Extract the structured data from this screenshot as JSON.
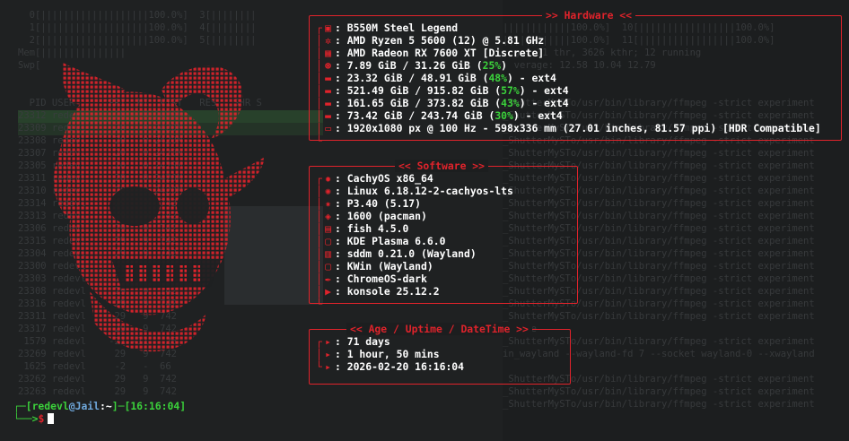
{
  "hardware": {
    "title": ">> Hardware <<",
    "items": [
      {
        "icon": "motherboard-icon",
        "text": "B550M Steel Legend"
      },
      {
        "icon": "cpu-icon",
        "text": "AMD Ryzen 5 5600 (12) @ 5.81 GHz"
      },
      {
        "icon": "gpu-icon",
        "text": "AMD Radeon RX 7600 XT [Discrete]"
      },
      {
        "icon": "memory-icon",
        "pre": "7.89 GiB / 31.26 GiB (",
        "pct": "25%",
        "post": ")"
      },
      {
        "icon": "disk-icon",
        "pre": "23.32 GiB / 48.91 GiB (",
        "pct": "48%",
        "post": ") - ext4"
      },
      {
        "icon": "disk-icon",
        "pre": "521.49 GiB / 915.82 GiB (",
        "pct": "57%",
        "post": ") - ext4"
      },
      {
        "icon": "disk-icon",
        "pre": "161.65 GiB / 373.82 GiB (",
        "pct": "43%",
        "post": ") - ext4"
      },
      {
        "icon": "disk-icon",
        "pre": "73.42 GiB / 243.74 GiB (",
        "pct": "30%",
        "post": ") - ext4"
      },
      {
        "icon": "display-icon",
        "text": "1920x1080 px @ 100 Hz - 598x336 mm (27.01 inches, 81.57 ppi) [HDR Compatible]"
      }
    ]
  },
  "software": {
    "title": "<< Software >>",
    "items": [
      {
        "icon": "os-icon",
        "text": "CachyOS x86_64"
      },
      {
        "icon": "kernel-icon",
        "text": "Linux 6.18.12-2-cachyos-lts"
      },
      {
        "icon": "init-icon",
        "text": "P3.40 (5.17)"
      },
      {
        "icon": "package-icon",
        "text": "1600 (pacman)"
      },
      {
        "icon": "shell-icon",
        "text": "fish 4.5.0"
      },
      {
        "icon": "desktop-icon",
        "text": "KDE Plasma 6.6.0"
      },
      {
        "icon": "login-manager-icon",
        "text": "sddm 0.21.0 (Wayland)"
      },
      {
        "icon": "window-manager-icon",
        "text": "KWin (Wayland)"
      },
      {
        "icon": "theme-icon",
        "text": "ChromeOS-dark"
      },
      {
        "icon": "terminal-icon",
        "text": "konsole 25.12.2"
      }
    ]
  },
  "uptime": {
    "title": "<< Age / Uptime / DateTime >>",
    "items": [
      {
        "icon": "age-icon",
        "text": "71 days"
      },
      {
        "icon": "uptime-icon",
        "text": "1 hour, 50 mins"
      },
      {
        "icon": "datetime-icon",
        "text": "2026-02-20 16:16:04"
      }
    ]
  },
  "prompt": {
    "user": "redevl",
    "host": "Jail",
    "path": "~",
    "time": "16:16:04",
    "symbol": "$"
  },
  "colors": {
    "accent": "#e0232b",
    "percent": "#3bd23b",
    "background": "#1c1e1f"
  }
}
